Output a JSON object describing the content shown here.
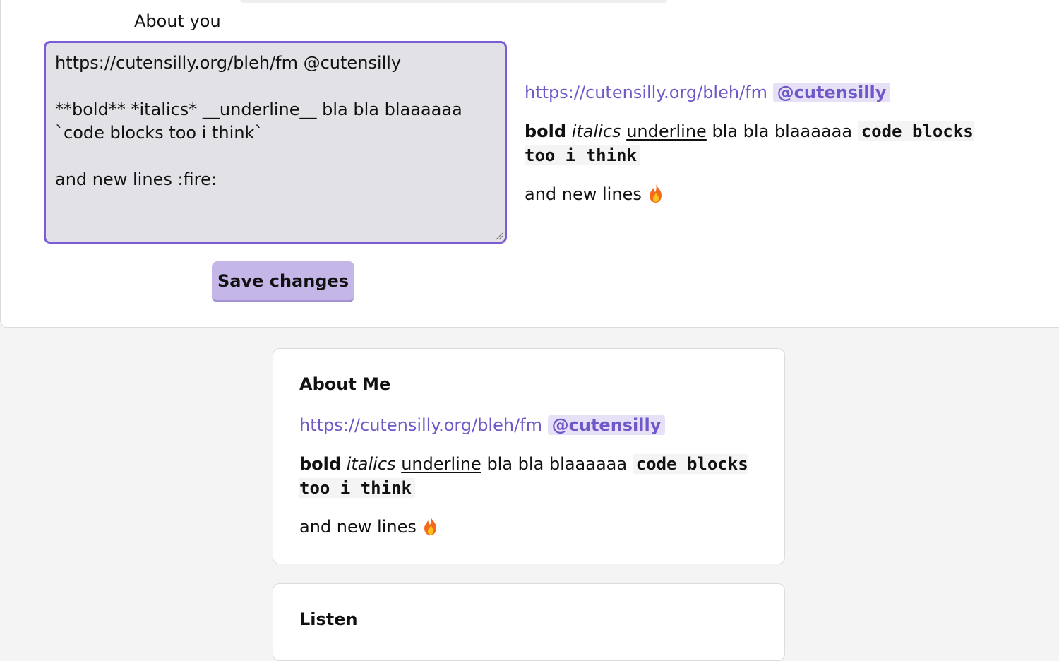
{
  "editor": {
    "label": "About you",
    "value": "https://cutensilly.org/bleh/fm @cutensilly\n\n**bold** *italics* __underline__ bla bla blaaaaaa\n`code blocks too i think`\n\nand new lines :fire:",
    "save_label": "Save changes"
  },
  "rendered": {
    "link": "https://cutensilly.org/bleh/fm",
    "mention": "@cutensilly",
    "bold": "bold",
    "italic": "italics",
    "underline": "underline",
    "plain": "bla bla blaaaaaa",
    "code": "code blocks too i think",
    "last_line": "and new lines",
    "emoji": "fire-icon"
  },
  "about_card": {
    "title": "About Me"
  },
  "listen_card": {
    "title": "Listen"
  },
  "colors": {
    "accent": "#7b5cd6",
    "link": "#7058c8",
    "button": "#c4b6e6",
    "textarea_bg": "#e2e1e6"
  }
}
